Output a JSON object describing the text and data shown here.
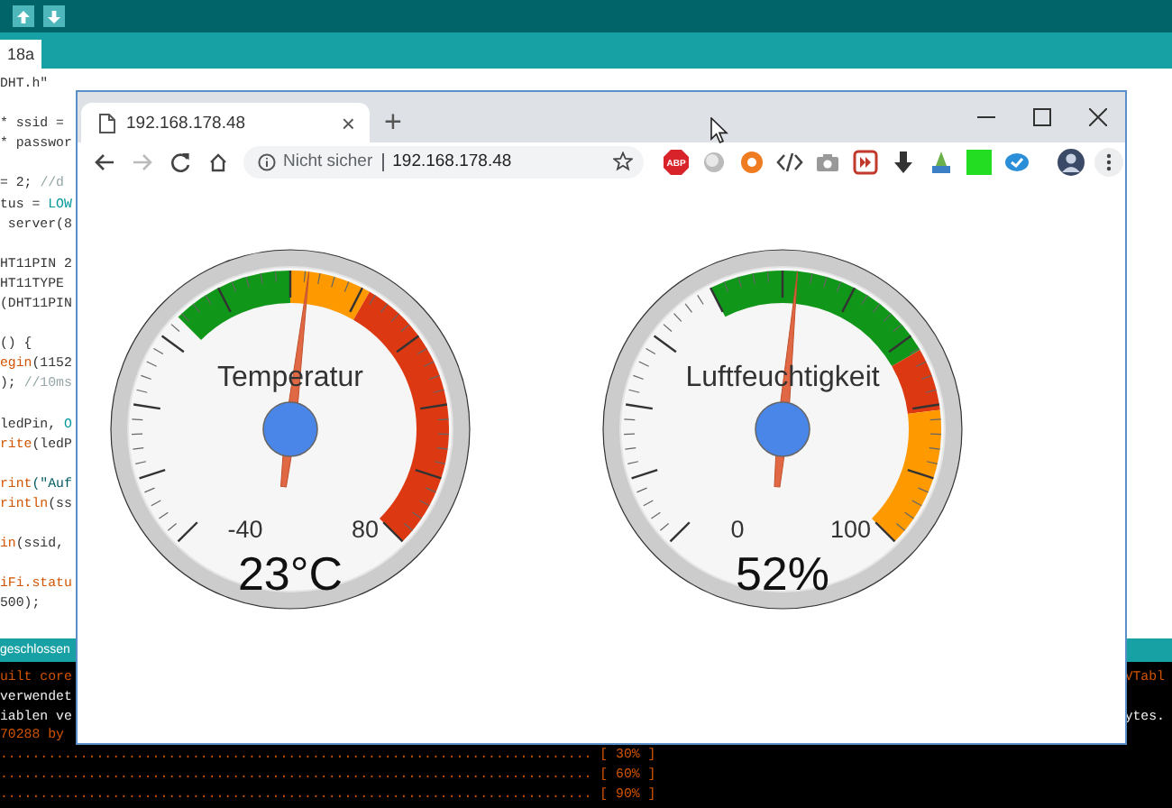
{
  "ide": {
    "toolbar_buttons": [
      {
        "kind": "up"
      },
      {
        "kind": "down"
      }
    ],
    "tab": "18a",
    "code_lines": [
      {
        "blank_before": false,
        "segments": [
          {
            "text": "DHT.h\"",
            "kind": "plain"
          }
        ]
      },
      {
        "blank_before": true,
        "segments": [
          {
            "text": "* ssid =",
            "kind": "plain"
          }
        ]
      },
      {
        "blank_before": false,
        "segments": [
          {
            "text": "* passwor",
            "kind": "plain"
          }
        ]
      },
      {
        "blank_before": true,
        "segments": [
          {
            "text": "= 2; ",
            "kind": "plain"
          },
          {
            "text": "//d",
            "kind": "comment"
          }
        ]
      },
      {
        "blank_before": false,
        "segments": [
          {
            "text": "tus = ",
            "kind": "plain"
          },
          {
            "text": "LOW",
            "kind": "constant"
          }
        ]
      },
      {
        "blank_before": false,
        "segments": [
          {
            "text": " server(8",
            "kind": "plain"
          }
        ]
      },
      {
        "blank_before": true,
        "segments": [
          {
            "text": "HT11PIN 2",
            "kind": "plain"
          }
        ]
      },
      {
        "blank_before": false,
        "segments": [
          {
            "text": "HT11TYPE",
            "kind": "plain"
          }
        ]
      },
      {
        "blank_before": false,
        "segments": [
          {
            "text": "(DHT11PIN",
            "kind": "plain"
          }
        ]
      },
      {
        "blank_before": true,
        "segments": [
          {
            "text": "() {",
            "kind": "plain"
          }
        ]
      },
      {
        "blank_before": false,
        "segments": [
          {
            "text": "egin",
            "kind": "keyword"
          },
          {
            "text": "(1152",
            "kind": "plain"
          }
        ]
      },
      {
        "blank_before": false,
        "segments": [
          {
            "text": "); ",
            "kind": "plain"
          },
          {
            "text": "//10ms",
            "kind": "comment"
          }
        ]
      },
      {
        "blank_before": true,
        "segments": [
          {
            "text": "ledPin, ",
            "kind": "plain"
          },
          {
            "text": "O",
            "kind": "constant"
          }
        ]
      },
      {
        "blank_before": false,
        "segments": [
          {
            "text": "rite",
            "kind": "keyword"
          },
          {
            "text": "(ledP",
            "kind": "plain"
          }
        ]
      },
      {
        "blank_before": true,
        "segments": [
          {
            "text": "rint",
            "kind": "keyword"
          },
          {
            "text": "(\"Auf",
            "kind": "string"
          }
        ]
      },
      {
        "blank_before": false,
        "segments": [
          {
            "text": "rintln",
            "kind": "keyword"
          },
          {
            "text": "(ss",
            "kind": "plain"
          }
        ]
      },
      {
        "blank_before": true,
        "segments": [
          {
            "text": "in",
            "kind": "keyword"
          },
          {
            "text": "(ssid,",
            "kind": "plain"
          }
        ]
      },
      {
        "blank_before": true,
        "segments": [
          {
            "text": "iFi.statu",
            "kind": "keyword"
          }
        ]
      },
      {
        "blank_before": false,
        "segments": [
          {
            "text": "500);",
            "kind": "plain"
          }
        ]
      }
    ],
    "status": "geschlossen",
    "console": [
      {
        "text": "uilt core",
        "kind": "warning",
        "right": "VTabl"
      },
      {
        "text": "verwendet",
        "kind": "info"
      },
      {
        "text": "iablen ve",
        "kind": "info",
        "right": "ytes."
      },
      {
        "text": "70288 by",
        "kind": "warning"
      },
      {
        "text": ".......................................................................... [ 30% ]",
        "kind": "warning"
      },
      {
        "text": ".......................................................................... [ 60% ]",
        "kind": "warning"
      },
      {
        "text": ".......................................................................... [ 90% ]",
        "kind": "warning"
      }
    ]
  },
  "browser": {
    "tab": {
      "title": "192.168.178.48",
      "close": "×"
    },
    "new_tab": "+",
    "omnibox": {
      "security": "Nicht sicher",
      "url": "192.168.178.48"
    },
    "extensions": [
      {
        "kind": "abp",
        "label": "ABP"
      },
      {
        "kind": "sphere"
      },
      {
        "kind": "lifebuoy"
      },
      {
        "kind": "code"
      },
      {
        "kind": "camera"
      },
      {
        "kind": "play"
      },
      {
        "kind": "download"
      },
      {
        "kind": "plant"
      },
      {
        "kind": "square"
      },
      {
        "kind": "check"
      }
    ],
    "gauges": [
      {
        "kind": "temperature",
        "title": "Temperatur",
        "min_label": "-40",
        "max_label": "80",
        "value": "23°C",
        "level": 0.525
      },
      {
        "kind": "humidity",
        "title": "Luftfeuchtigkeit",
        "min_label": "0",
        "max_label": "100",
        "value": "52%",
        "level": 0.52
      }
    ]
  }
}
